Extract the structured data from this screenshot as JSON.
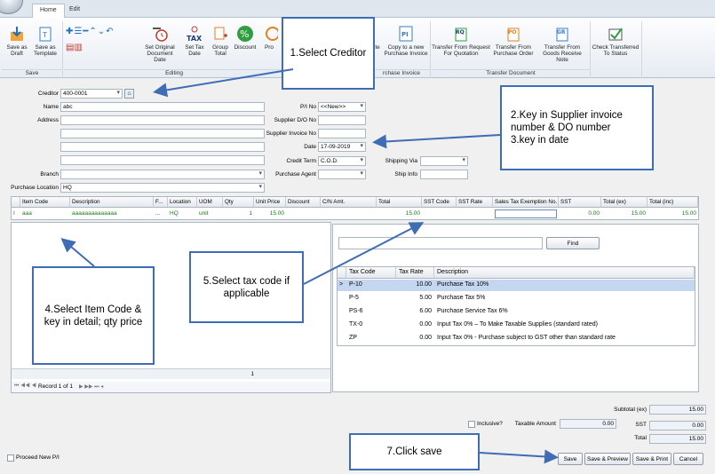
{
  "ribbon": {
    "tabs": [
      "Home",
      "Edit"
    ],
    "buttons": {
      "save_as_draft": "Save as Draft",
      "save_as_template": "Save as Template",
      "set_original_date": "Set Original Document Date",
      "set_tax_date": "Set Tax Date",
      "group_total": "Group Total",
      "discount": "Discount",
      "pro": "Pro",
      "copy_suffix": "te",
      "copy_to_new_pi": "Copy to a new Purchase Invoice",
      "transfer_from_request": "Transfer From Request For Quotation",
      "transfer_from_po": "Transfer From Purchase Order",
      "transfer_from_grn": "Transfer From Goods Receive Note",
      "check_transferred": "Check Transferred To Status"
    },
    "icon_text": {
      "tax": "TAX",
      "percent": "%",
      "ro": "RQ",
      "po": "PO",
      "gr": "GR",
      "pi": "PI"
    },
    "groups": {
      "save": "Save",
      "editing": "Editing",
      "purchase_invoice": "rchase Invoice",
      "transfer_document": "Transfer Document"
    }
  },
  "form": {
    "creditor_label": "Creditor",
    "creditor_value": "400-0001",
    "name_label": "Name",
    "name_value": "abc",
    "address_label": "Address",
    "branch_label": "Branch",
    "purchase_location_label": "Purchase Location",
    "purchase_location_value": "HQ",
    "pi_no_label": "P/I No",
    "pi_no_value": "<<New>>",
    "supplier_do_label": "Supplier D/O No",
    "supplier_invoice_label": "Supplier Invoice No",
    "date_label": "Date",
    "date_value": "17-09-2019",
    "credit_term_label": "Credit Term",
    "credit_term_value": "C.O.D.",
    "purchase_agent_label": "Purchase Agent",
    "shipping_via_label": "Shipping Via",
    "ship_info_label": "Ship Info"
  },
  "grid": {
    "columns": [
      "Item Code",
      "Description",
      "F...",
      "Location",
      "UOM",
      "Qty",
      "Unit Price",
      "Discount",
      "C/N Amt.",
      "Total",
      "SST Code",
      "SST Rate",
      "Sales Tax Exemption No.",
      "SST",
      "Total (ex)",
      "Total (inc)"
    ],
    "row": {
      "item_code": "aaa",
      "description": "aaaaaaaaaaaaaa",
      "f": "...",
      "location": "HQ",
      "uom": "unit",
      "qty": "1",
      "unit_price": "15.00",
      "total": "15.00",
      "sst": "0.00",
      "total_ex": "15.00",
      "total_inc": "15.00"
    },
    "footer_qty": "1",
    "navigator": "Record 1 of 1"
  },
  "lookup": {
    "find_label": "Find",
    "columns": [
      "Tax Code",
      "Tax Rate",
      "Description"
    ],
    "rows": [
      {
        "code": "P-10",
        "rate": "10.00",
        "desc": "Purchase Tax 10%"
      },
      {
        "code": "P-5",
        "rate": "5.00",
        "desc": "Purchase Tax 5%"
      },
      {
        "code": "PS-6",
        "rate": "6.00",
        "desc": "Purchase Service Tax 6%"
      },
      {
        "code": "TX-0",
        "rate": "0.00",
        "desc": "Input Tax 0% – To Make Taxable Supplies (standard rated)"
      },
      {
        "code": "ZP",
        "rate": "0.00",
        "desc": "Input Tax 0% - Purchase subject to GST other than standard rate"
      }
    ]
  },
  "totals": {
    "subtotal_label": "Subtotal (ex)",
    "subtotal_value": "15.00",
    "inclusive_label": "Inclusive?",
    "taxable_amount_label": "Taxable Amount",
    "taxable_amount_value": "0.00",
    "sst_label": "SST",
    "sst_value": "0.00",
    "total_label": "Total",
    "total_value": "15.00"
  },
  "bottom": {
    "proceed_new_pi": "Proceed New P/I",
    "save": "Save",
    "save_preview": "Save & Preview",
    "save_print": "Save & Print",
    "cancel": "Cancel"
  },
  "annotations": {
    "step1": "1.Select Creditor",
    "step2": "2.Key in Supplier invoice number & DO number",
    "step3": "3.key in date",
    "step4": "4.Select Item Code & key in detail; qty price",
    "step5": "5.Select tax code if applicable",
    "step7": "7.Click save"
  },
  "colors": {
    "accent": "#3f6db5",
    "selected_row": "#c5d7f0",
    "grid_text": "#1a7a1a"
  }
}
